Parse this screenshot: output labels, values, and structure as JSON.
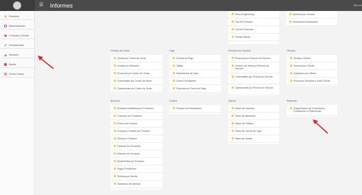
{
  "header": {
    "title": "Informes",
    "user": "Bienve"
  },
  "sidebar": {
    "items": [
      {
        "label": "Favoritos",
        "icon": "star-icon",
        "chevron": "‹"
      },
      {
        "label": "Administración",
        "icon": "gear-icon"
      },
      {
        "label": "Compras y Stocks",
        "icon": "cart-icon"
      },
      {
        "label": "Herramientas",
        "icon": "wrench-icon"
      },
      {
        "label": "Informes",
        "icon": "chart-icon"
      },
      {
        "label": "Ayuda",
        "icon": "help-icon"
      },
      {
        "label": "Cerrar Sesión",
        "icon": "power-icon"
      }
    ]
  },
  "cards": {
    "top": {
      "items": [
        "Menú Engineering",
        "Top 50 Formatos",
        "Top 50 Productos",
        "Ventas Diarias"
      ]
    },
    "top_right": {
      "items": [
        "Ausencia por Usuario",
        "Descuentos Autorizados"
      ]
    },
    "centros": {
      "title": "Centros de Venta",
      "items": [
        "Ventas por Centro de Venta",
        "Ventas por Ubicación",
        "Productos por Centro de Venta",
        "Comensales por Centro de Venta",
        "Operaciones por Centro de Venta"
      ]
    },
    "caja": {
      "title": "Caja",
      "items": [
        "Formas de Pago",
        "Tarifas",
        "Movimientos de Caja",
        "Cobros Pendientes",
        "Propinas por Forma de Pago"
      ]
    },
    "periodos": {
      "title": "Periodos de Servicio",
      "items": [
        "Productos por Periodo de Servicio",
        "Centros de Venta por Periodo de Servicio",
        "Comensales por Periodo de Servicio",
        "Operaciones por Periodo de Servicio"
      ]
    },
    "clientes": {
      "title": "Clientes",
      "items": [
        "Ventas a Cliente",
        "Facturas por Cliente",
        "Impuestos por Cliente",
        "Productos Vendidos a Cada Cliente"
      ]
    },
    "almacen": {
      "title": "Almacén",
      "items": [
        "Entradas Detalladas por Proveedor",
        "Compras por Proveedor",
        "Precios de Compra",
        "Compras y Ventas por Producto",
        "Stock por Producto",
        "Facturas de Proveedor",
        "Histórico de Compras",
        "Movimientos por Producto",
        "Pagos Pendientes",
        "Pedidos por Recibir",
        "Valoración de Mermas"
      ]
    },
    "cocina": {
      "title": "Cocina",
      "items": [
        "Tiempos de Preparación"
      ]
    },
    "diarios": {
      "title": "Diarios",
      "items": [
        "Diario de Facturas",
        "Diario de Albaranes",
        "Diario de Pedidos",
        "Diario de Cierres de Caja",
        "Diario de Ventas"
      ]
    },
    "sistemas": {
      "title": "Sistemas",
      "items": [
        "Carga Masiva de Proveedores, Condiciones y Referencias"
      ]
    }
  },
  "colors": {
    "accent": "#f3c34d",
    "arrow": "#d9262e",
    "topbar": "#4a4a4a"
  }
}
